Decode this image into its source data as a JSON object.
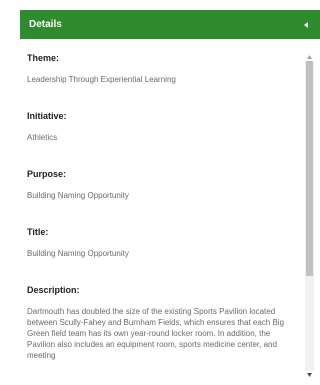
{
  "header": {
    "title": "Details",
    "collapse_icon": "chevron-left-icon",
    "color": "#2e8b2e"
  },
  "fields": [
    {
      "label": "Theme:",
      "value": "Leadership Through Experiential Learning"
    },
    {
      "label": "Initiative:",
      "value": "Athletics"
    },
    {
      "label": "Purpose:",
      "value": "Building Naming Opportunity"
    },
    {
      "label": "Title:",
      "value": "Building Naming Opportunity"
    },
    {
      "label": "Description:",
      "value": "Dartmouth has doubled the size of the existing Sports Pavilion located between Scully-Fahey and Burnham Fields, which ensures that each Big Green field team has its own year-round locker room. In addition, the Pavilion also includes an equipment room, sports medicine center, and meeting"
    }
  ],
  "scrollbar": {
    "up_icon": "scroll-up-arrow-icon",
    "down_icon": "scroll-down-arrow-icon"
  }
}
